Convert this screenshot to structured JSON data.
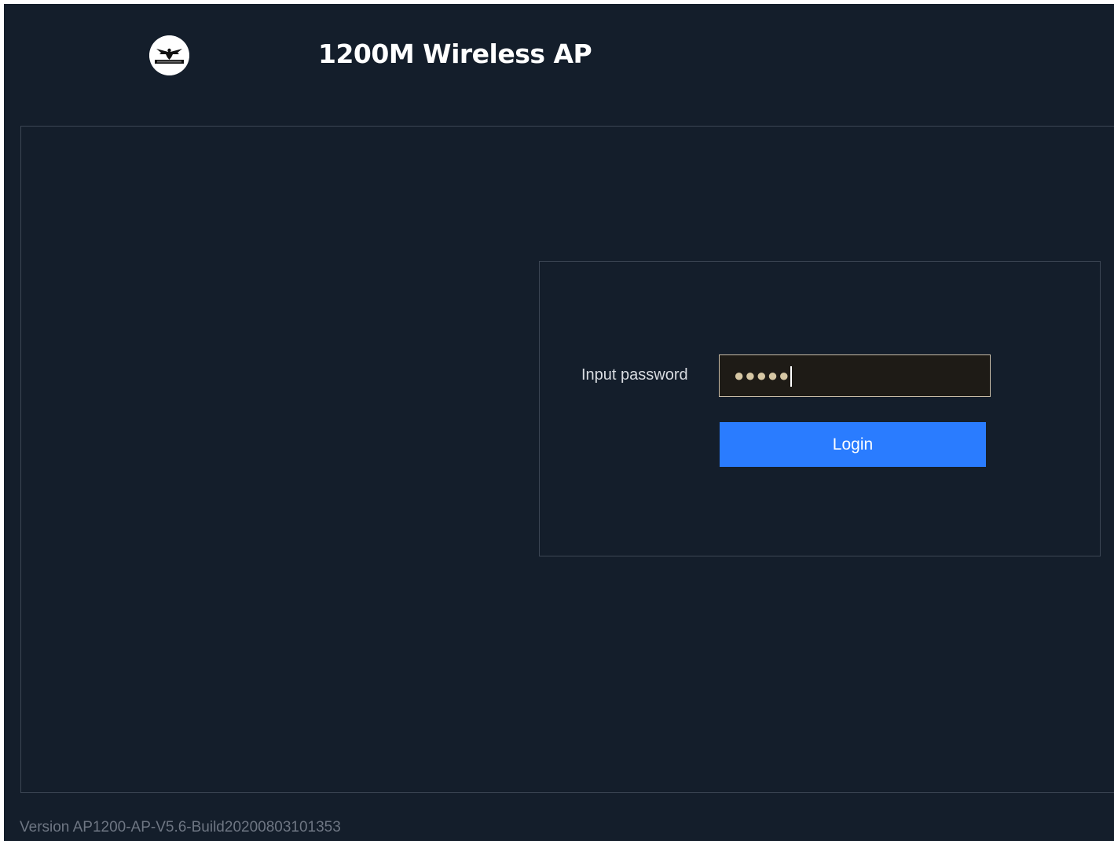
{
  "header": {
    "title": "1200M Wireless AP",
    "logo_icon": "eagle-badge-icon"
  },
  "login": {
    "password_label": "Input password",
    "password_masked": "●●●●●",
    "login_button": "Login"
  },
  "footer": {
    "version": "Version AP1200-AP-V5.6-Build20200803101353"
  },
  "colors": {
    "background": "#141e2b",
    "accent": "#2a7cff",
    "input_background": "#1e1b16",
    "input_border": "#c8bca6",
    "panel_border": "#3c4654"
  }
}
